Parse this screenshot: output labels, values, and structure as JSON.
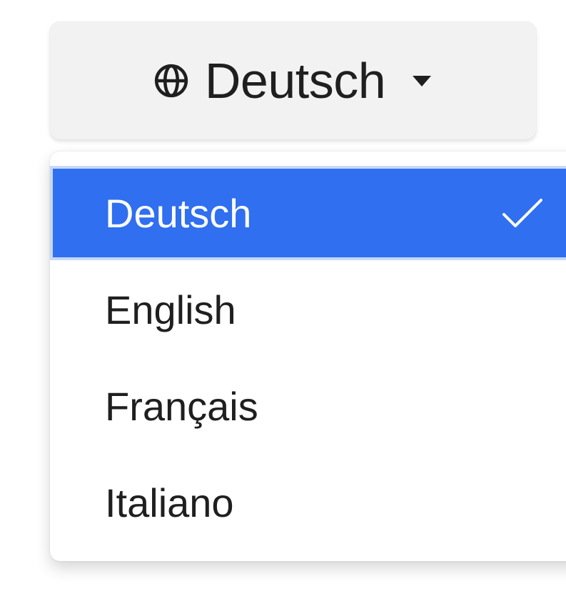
{
  "language_button": {
    "label": "Deutsch",
    "icon": "globe-icon",
    "caret_icon": "caret-down-icon"
  },
  "language_menu": {
    "items": [
      {
        "label": "Deutsch",
        "selected": true,
        "check_icon": "checkmark-icon"
      },
      {
        "label": "English",
        "selected": false
      },
      {
        "label": "Français",
        "selected": false
      },
      {
        "label": "Italiano",
        "selected": false
      }
    ]
  },
  "colors": {
    "selected_background": "#2f6ff0",
    "selected_outline": "#c7d8f8",
    "button_background": "#f2f2f2",
    "text": "#1f1f1f"
  }
}
